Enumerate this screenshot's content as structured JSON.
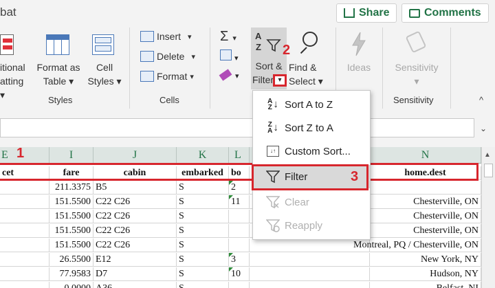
{
  "window": {
    "title_fragment": "bat"
  },
  "header_buttons": {
    "share": "Share",
    "comments": "Comments"
  },
  "ribbon": {
    "styles_group": {
      "label": "Styles",
      "conditional_formatting": [
        "itional",
        "atting"
      ],
      "format_as_table": [
        "Format as",
        "Table"
      ],
      "cell_styles": [
        "Cell",
        "Styles"
      ]
    },
    "cells_group": {
      "label": "Cells",
      "insert": "Insert",
      "delete": "Delete",
      "format": "Format"
    },
    "editing_group": {
      "sort_filter": [
        "Sort &",
        "Filter"
      ],
      "find_select": [
        "Find &",
        "Select"
      ]
    },
    "ideas_label": "Ideas",
    "sensitivity_group": {
      "button": "Sensitivity",
      "label": "Sensitivity"
    }
  },
  "sort_filter_menu": {
    "items": [
      {
        "label": "Sort A to Z",
        "enabled": true
      },
      {
        "label": "Sort Z to A",
        "enabled": true
      },
      {
        "label": "Custom Sort...",
        "enabled": true
      },
      {
        "label": "Filter",
        "enabled": true,
        "highlighted": true
      },
      {
        "label": "Clear",
        "enabled": false
      },
      {
        "label": "Reapply",
        "enabled": false
      }
    ]
  },
  "annotations": [
    "1",
    "2",
    "3"
  ],
  "annotation_color": "#d7262d",
  "sheet": {
    "column_letters": [
      "E",
      "I",
      "J",
      "K",
      "L",
      "N"
    ],
    "headers": [
      "cet",
      "fare",
      "cabin",
      "embarked",
      "bo",
      "home.dest"
    ],
    "rows": [
      {
        "fare": "211.3375",
        "cabin": "B5",
        "embarked": "S",
        "boat": "2",
        "home_dest": ""
      },
      {
        "fare": "151.5500",
        "cabin": "C22 C26",
        "embarked": "S",
        "boat": "11",
        "home_dest": "Chesterville, ON"
      },
      {
        "fare": "151.5500",
        "cabin": "C22 C26",
        "embarked": "S",
        "boat": "",
        "home_dest": "Chesterville, ON"
      },
      {
        "fare": "151.5500",
        "cabin": "C22 C26",
        "embarked": "S",
        "boat": "",
        "home_dest": "Chesterville, ON"
      },
      {
        "fare": "151.5500",
        "cabin": "C22 C26",
        "embarked": "S",
        "boat": "",
        "home_dest": "Montreal, PQ / Chesterville, ON"
      },
      {
        "fare": "26.5500",
        "cabin": "E12",
        "embarked": "S",
        "boat": "3",
        "home_dest": "New York, NY"
      },
      {
        "fare": "77.9583",
        "cabin": "D7",
        "embarked": "S",
        "boat": "10",
        "home_dest": "Hudson, NY"
      },
      {
        "fare": "0.0000",
        "cabin": "A36",
        "embarked": "S",
        "boat": "",
        "home_dest": "Belfast, NI"
      }
    ]
  }
}
